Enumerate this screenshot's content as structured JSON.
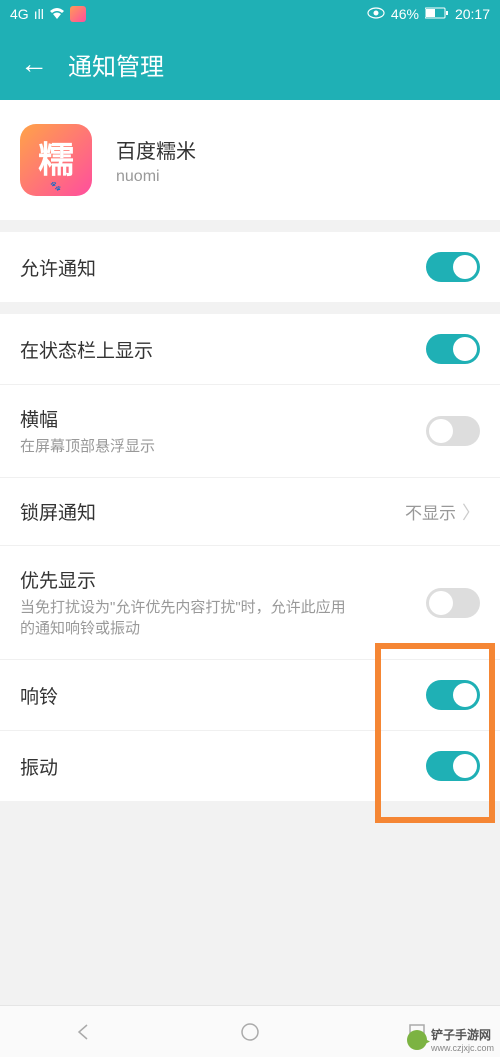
{
  "status": {
    "signal": "4G",
    "battery_pct": "46%",
    "time": "20:17"
  },
  "header": {
    "title": "通知管理"
  },
  "app": {
    "icon_char": "糯",
    "name": "百度糯米",
    "id": "nuomi"
  },
  "settings": {
    "allow_notifications": {
      "label": "允许通知",
      "on": true
    },
    "status_bar": {
      "label": "在状态栏上显示",
      "on": true
    },
    "banner": {
      "label": "横幅",
      "desc": "在屏幕顶部悬浮显示",
      "on": false
    },
    "lock_screen": {
      "label": "锁屏通知",
      "value": "不显示"
    },
    "priority": {
      "label": "优先显示",
      "desc": "当免打扰设为\"允许优先内容打扰\"时，允许此应用的通知响铃或振动",
      "on": false
    },
    "ring": {
      "label": "响铃",
      "on": true
    },
    "vibrate": {
      "label": "振动",
      "on": true
    }
  },
  "watermark": {
    "brand": "铲子手游网",
    "url": "www.czjxjc.com"
  }
}
